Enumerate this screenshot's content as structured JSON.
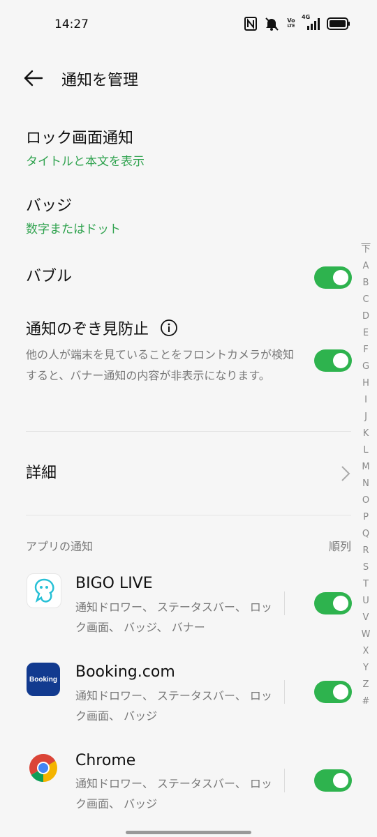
{
  "status_bar": {
    "time": "14:27",
    "icons": [
      "nfc-icon",
      "mute-icon",
      "volte-icon",
      "signal-4g-icon",
      "battery-icon"
    ],
    "volte_top": "Vo",
    "volte_bottom": "LTE",
    "network": "4G"
  },
  "header": {
    "title": "通知を管理"
  },
  "settings": {
    "lock_screen": {
      "title": "ロック画面通知",
      "value": "タイトルと本文を表示"
    },
    "badge": {
      "title": "バッジ",
      "value": "数字またはドット"
    },
    "bubble": {
      "title": "バブル",
      "enabled": true
    },
    "peek_prevention": {
      "title": "通知のぞき見防止",
      "description": "他の人が端末を見ていることをフロントカメラが検知すると、バナー通知の内容が非表示になります。",
      "enabled": true
    },
    "details": {
      "title": "詳細"
    }
  },
  "app_notifications": {
    "section_label": "アプリの通知",
    "sort_label": "順列",
    "apps": [
      {
        "name": "BIGO LIVE",
        "desc": "通知ドロワー、 ステータスバー、 ロック画面、 バッジ、 バナー",
        "enabled": true,
        "icon": "bigo-live-icon"
      },
      {
        "name": "Booking.com",
        "desc": "通知ドロワー、 ステータスバー、 ロック画面、 バッジ",
        "enabled": true,
        "icon": "booking-icon",
        "icon_text": "Booking"
      },
      {
        "name": "Chrome",
        "desc": "通知ドロワー、 ステータスバー、 ロック画面、 バッジ",
        "enabled": true,
        "icon": "chrome-icon"
      }
    ]
  },
  "alpha_index": [
    "̅下",
    "A",
    "B",
    "C",
    "D",
    "E",
    "F",
    "G",
    "H",
    "I",
    "J",
    "K",
    "L",
    "M",
    "N",
    "O",
    "P",
    "Q",
    "R",
    "S",
    "T",
    "U",
    "V",
    "W",
    "X",
    "Y",
    "Z",
    "#"
  ],
  "colors": {
    "accent": "#2fa24e",
    "toggle_on": "#2eb34e",
    "background": "#f6f6f6",
    "booking_blue": "#123a8f"
  }
}
